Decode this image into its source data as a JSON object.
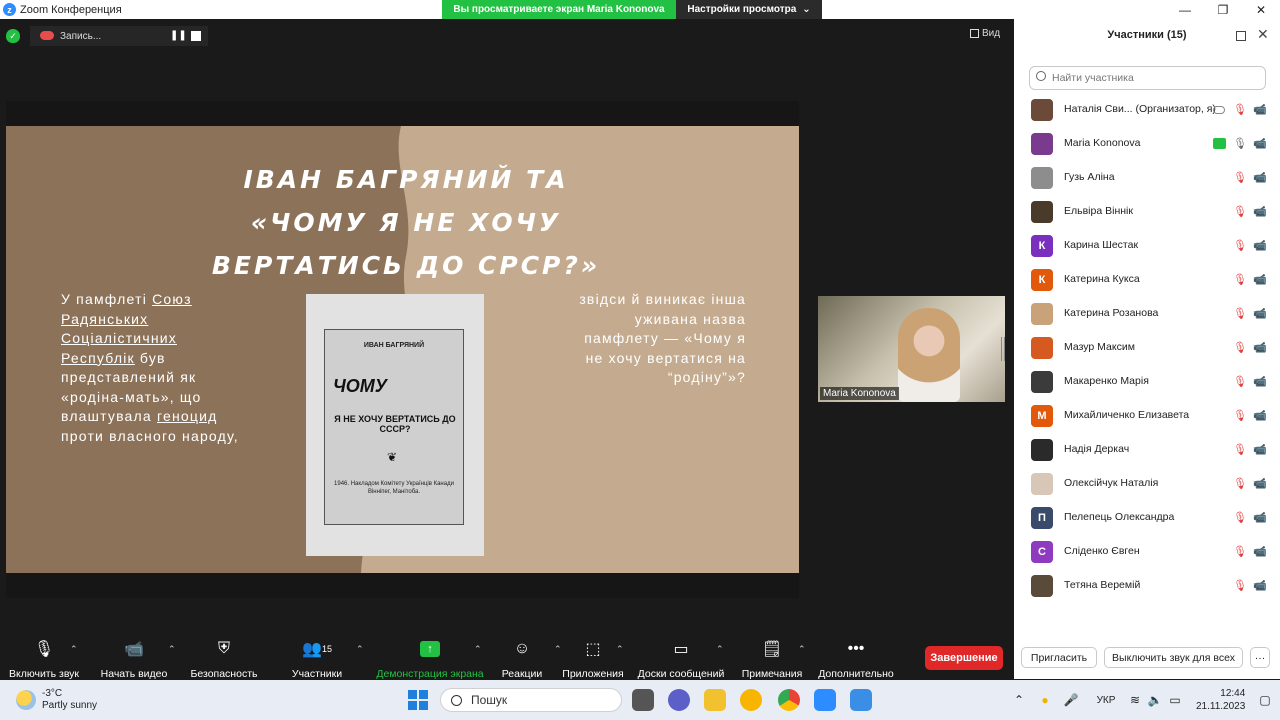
{
  "window": {
    "title": "Zoom Конференция",
    "share_banner": "Вы просматриваете экран Maria Kononova",
    "view_options": "Настройки просмотра"
  },
  "recording": {
    "label": "Запись..."
  },
  "view_button": "Вид",
  "slide": {
    "title": "Іван Багряний та «Чому я не хочу вертатись до СРСР?»",
    "left_text": {
      "p1": "У памфлеті ",
      "link1": "Союз Радянських Соціалістичних Республік",
      "p2": " був представлений як «родіна-мать», що влаштувала ",
      "link2": "геноцид",
      "p3": " проти власного народу,"
    },
    "right_text": "звідси й виникає інша уживана назва памфлету — «Чому я не хочу вертатися на “родіну”»?",
    "book": {
      "author": "ИВАН БАГРЯНИЙ",
      "title1": "ЧОМУ",
      "title2": "Я НЕ ХОЧУ ВЕРТАТИСЬ ДО СССР?",
      "footer": "1946. Накладом Комітету Українців Канади Вінніпег, Манітоба."
    }
  },
  "video": {
    "name": "Maria Kononova"
  },
  "toolbar": {
    "mic": "Включить звук",
    "video": "Начать видео",
    "security": "Безопасность",
    "participants": "Участники",
    "participants_count": "15",
    "share": "Демонстрация экрана",
    "reactions": "Реакции",
    "apps": "Приложения",
    "whiteboards": "Доски сообщений",
    "notes": "Примечания",
    "more": "Дополнительно",
    "end": "Завершение"
  },
  "panel": {
    "title": "Участники (15)",
    "search_placeholder": "Найти участника",
    "participants": [
      {
        "name": "Наталія Сви... (Организатор, я)",
        "initial": "",
        "color": "#6b4a3a"
      },
      {
        "name": "Maria Kononova",
        "initial": "",
        "color": "#7a3b8e"
      },
      {
        "name": "Гузь Аліна",
        "initial": "",
        "color": "#8d8d8d"
      },
      {
        "name": "Ельвіра Віннік",
        "initial": "",
        "color": "#4a3a2a"
      },
      {
        "name": "Карина Шестак",
        "initial": "К",
        "color": "#7b2fbf"
      },
      {
        "name": "Катерина Кукса",
        "initial": "К",
        "color": "#e2590c"
      },
      {
        "name": "Катерина Розанова",
        "initial": "",
        "color": "#c9a27a"
      },
      {
        "name": "Мазур Максим",
        "initial": "",
        "color": "#d65a1f"
      },
      {
        "name": "Макаренко Марія",
        "initial": "",
        "color": "#3b3b3b"
      },
      {
        "name": "Михайличенко Елизавета",
        "initial": "М",
        "color": "#e2590c"
      },
      {
        "name": "Надія Деркач",
        "initial": "",
        "color": "#2a2a2a"
      },
      {
        "name": "Олексійчук Наталія",
        "initial": "",
        "color": "#d8c7b6"
      },
      {
        "name": "Пелепець Олександра",
        "initial": "П",
        "color": "#3a4a6b"
      },
      {
        "name": "Сліденко Євген",
        "initial": "С",
        "color": "#8e3bbf"
      },
      {
        "name": "Тетяна Веремій",
        "initial": "",
        "color": "#5a4a3a"
      }
    ],
    "invite": "Пригласить",
    "unmute_all": "Выключить звук для всех",
    "more": "···"
  },
  "taskbar": {
    "temp": "-3°C",
    "weather": "Partly sunny",
    "search": "Пошук",
    "lang": "УКР",
    "time": "12:44",
    "date": "21.11.2023"
  }
}
